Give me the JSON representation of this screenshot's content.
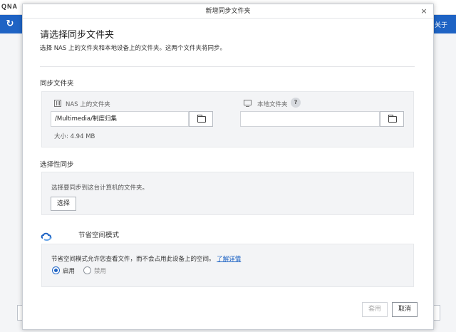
{
  "background": {
    "logo": "QNA",
    "right_text": "关于"
  },
  "dialog": {
    "title": "新增同步文件夹",
    "close_label": "×",
    "heading": "请选择同步文件夹",
    "subtext": "选择 NAS 上的文件夹和本地设备上的文件夹。这两个文件夹将同步。",
    "sync_folders": {
      "title": "同步文件夹",
      "nas_label": "NAS 上的文件夹",
      "nas_path": "/Multimedia/制度归集",
      "size_text": "大小: 4.94 MB",
      "local_label": "本地文件夹",
      "local_path": "",
      "help_label": "?"
    },
    "selective_sync": {
      "title": "选择性同步",
      "description": "选择要同步到这台计算机的文件夹。",
      "select_button": "选择"
    },
    "space_saving": {
      "title": "节省空间模式",
      "description": "节省空间模式允许您查看文件，而不会占用此设备上的空间。",
      "learn_more": "了解详情",
      "options": [
        {
          "label": "启用",
          "checked": true
        },
        {
          "label": "禁用",
          "checked": false
        }
      ]
    },
    "footer": {
      "apply_label": "套用",
      "cancel_label": "取消"
    }
  },
  "colors": {
    "accent": "#1e63c4",
    "panel_bg": "#f3f4f6"
  }
}
